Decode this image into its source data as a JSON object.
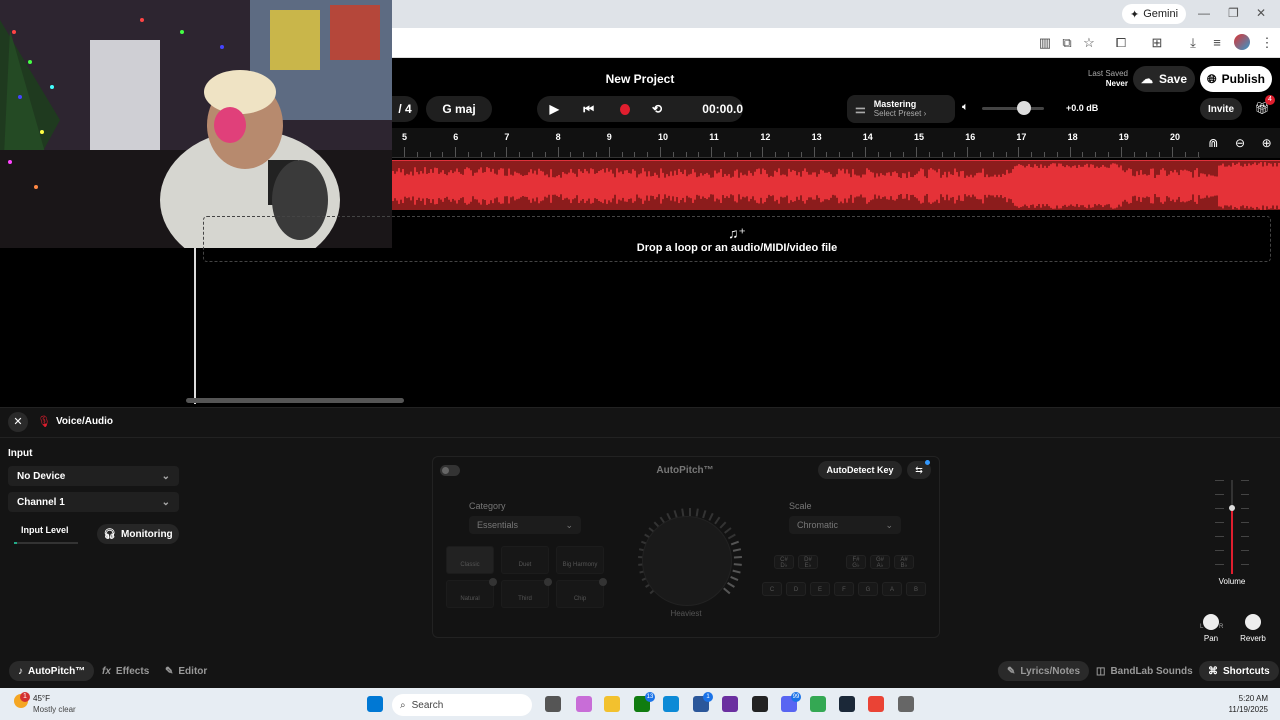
{
  "browser": {
    "gemini_label": "Gemini",
    "minimize_icon": "—",
    "restore_icon": "❐",
    "close_icon": "✕"
  },
  "header": {
    "title": "New Project",
    "time_signature_fragment": "/ 4",
    "key": "G maj",
    "time": "00:00.0",
    "mastering_title": "Mastering",
    "mastering_preset": "Select Preset",
    "volume_db": "+0.0 dB",
    "last_saved_label": "Last Saved",
    "last_saved_value": "Never",
    "save_label": "Save",
    "publish_label": "Publish",
    "invite_label": "Invite",
    "gift_badge": "4"
  },
  "ruler": {
    "bars": [
      "5",
      "6",
      "7",
      "8",
      "9",
      "10",
      "11",
      "12",
      "13",
      "14",
      "15",
      "16",
      "17",
      "18",
      "19",
      "20"
    ]
  },
  "track": {
    "drop_text": "Drop a loop or an audio/MIDI/video file"
  },
  "panel": {
    "track_name": "Voice/Audio",
    "input_label": "Input",
    "device": "No Device",
    "channel": "Channel 1",
    "input_level_label": "Input Level",
    "monitoring_label": "Monitoring",
    "autopitch": {
      "title": "AutoPitch™",
      "autodetect_label": "AutoDetect Key",
      "category_label": "Category",
      "category_value": "Essentials",
      "scale_label": "Scale",
      "scale_value": "Chromatic",
      "knob_label": "Heaviest",
      "styles": [
        "Classic",
        "Duet",
        "Big Harmony",
        "Natural",
        "Third",
        "Chip"
      ],
      "sharps": [
        {
          "top": "C#",
          "bottom": "D♭"
        },
        {
          "top": "D#",
          "bottom": "E♭"
        },
        {
          "top": "F#",
          "bottom": "G♭"
        },
        {
          "top": "G#",
          "bottom": "A♭"
        },
        {
          "top": "A#",
          "bottom": "B♭"
        }
      ],
      "naturals": [
        "C",
        "D",
        "E",
        "F",
        "G",
        "A",
        "B"
      ]
    },
    "volume_label": "Volume",
    "pan_label": "Pan",
    "reverb_label": "Reverb",
    "pan_left": "L",
    "pan_right": "R"
  },
  "bottom_tabs": {
    "autopitch": "AutoPitch™",
    "effects": "Effects",
    "editor": "Editor",
    "lyrics": "Lyrics/Notes",
    "bandlab_sounds": "BandLab Sounds",
    "shortcuts": "Shortcuts"
  },
  "taskbar": {
    "weather_temp": "45°F",
    "weather_desc": "Mostly clear",
    "weather_badge": "1",
    "search_placeholder": "Search",
    "badge_xbox": "13",
    "badge_store": "1",
    "badge_discord": "99",
    "time": "5:20 AM",
    "date": "11/19/2025"
  },
  "colors": {
    "accent_red": "#e01e2e",
    "waveform": "#e53238",
    "background": "#000000"
  }
}
